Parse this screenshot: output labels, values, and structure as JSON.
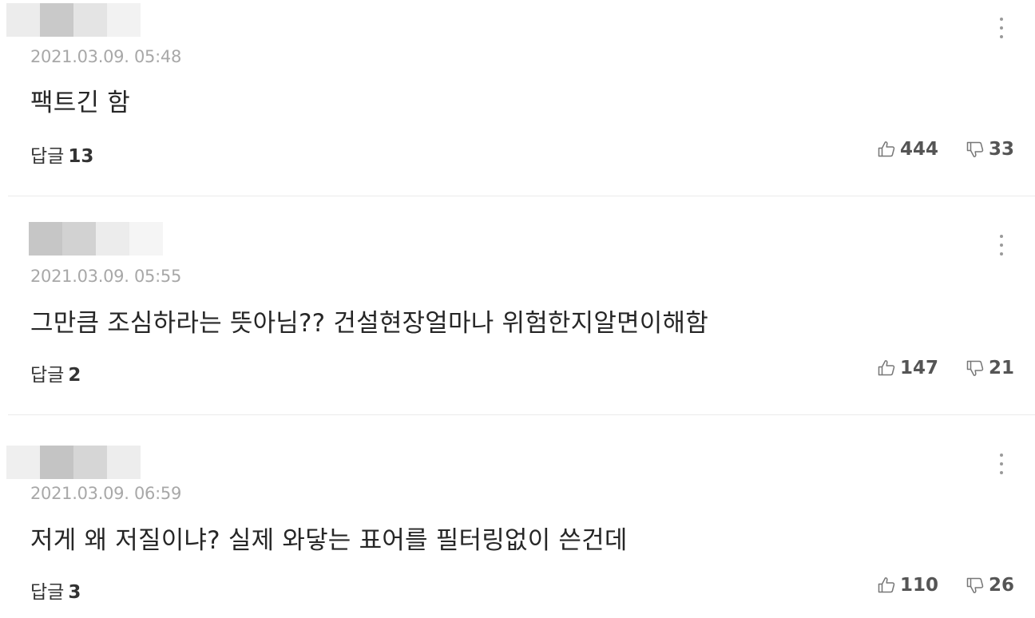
{
  "comments": [
    {
      "date": "2021.03.09. 05:48",
      "text": "팩트긴 함",
      "reply_label": "답글",
      "reply_count": "13",
      "likes": "444",
      "dislikes": "33",
      "blur_colors": [
        "#ececec",
        "#c9c9c9",
        "#e4e4e4",
        "#f2f2f2"
      ]
    },
    {
      "date": "2021.03.09. 05:55",
      "text": "그만큼 조심하라는 뜻아님?? 건설현장얼마나 위험한지알면이해함",
      "reply_label": "답글",
      "reply_count": "2",
      "likes": "147",
      "dislikes": "21",
      "blur_colors": [
        "#c6c6c6",
        "#d2d2d2",
        "#ececec",
        "#f5f5f5"
      ]
    },
    {
      "date": "2021.03.09. 06:59",
      "text": "저게 왜 저질이냐? 실제 와닿는 표어를 필터링없이 쓴건데",
      "reply_label": "답글",
      "reply_count": "3",
      "likes": "110",
      "dislikes": "26",
      "blur_colors": [
        "#efefef",
        "#c4c4c4",
        "#d6d6d6",
        "#ededed"
      ]
    }
  ],
  "icons": {
    "more": "more-vertical-icon",
    "like": "thumbs-up-icon",
    "dislike": "thumbs-down-icon"
  }
}
